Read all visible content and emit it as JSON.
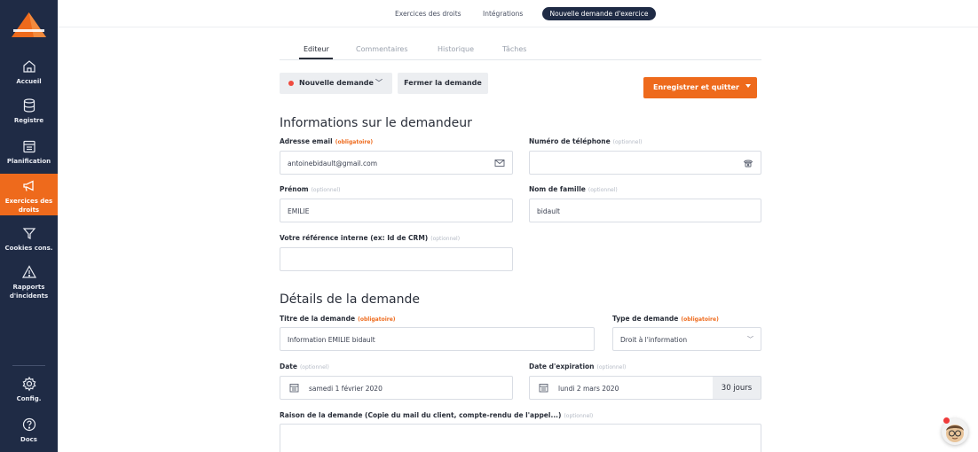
{
  "sidebar": {
    "items": [
      {
        "label": "Accueil",
        "icon": "home-icon"
      },
      {
        "label": "Registre",
        "icon": "database-icon"
      },
      {
        "label": "Planification",
        "icon": "calendar-icon"
      },
      {
        "label": "Exercices des droits",
        "icon": "megaphone-icon",
        "active": true
      },
      {
        "label": "Cookies cons.",
        "icon": "filter-icon"
      },
      {
        "label": "Rapports d'incidents",
        "icon": "warning-icon"
      }
    ],
    "bottom": [
      {
        "label": "Config.",
        "icon": "gear-icon"
      },
      {
        "label": "Docs",
        "icon": "help-icon"
      }
    ]
  },
  "topnav": {
    "links": [
      "Exercices des droits",
      "Intégrations"
    ],
    "active_pill": "Nouvelle demande d'exercice"
  },
  "tabs": [
    "Editeur",
    "Commentaires",
    "Historique",
    "Tâches"
  ],
  "toolbar": {
    "status_label": "Nouvelle demande",
    "close_label": "Fermer la demande",
    "save_label": "Enregistrer et quitter"
  },
  "requester": {
    "title": "Informations sur le demandeur",
    "email": {
      "label": "Adresse email",
      "tag": "(obligatoire)",
      "value": "antoinebidault@gmail.com"
    },
    "phone": {
      "label": "Numéro de téléphone",
      "tag": "(optionnel)",
      "value": ""
    },
    "firstname": {
      "label": "Prénom",
      "tag": "(optionnel)",
      "value": "EMILIE"
    },
    "lastname": {
      "label": "Nom de famille",
      "tag": "(optionnel)",
      "value": "bidault"
    },
    "reference": {
      "label": "Votre référence interne (ex: Id de CRM)",
      "tag": "(optionnel)",
      "value": ""
    }
  },
  "details": {
    "title": "Détails de la demande",
    "request_title": {
      "label": "Titre de la demande",
      "tag": "(obligatoire)",
      "value": "Information EMILIE bidault"
    },
    "request_type": {
      "label": "Type de demande",
      "tag": "(obligatoire)",
      "value": "Droit à l'information"
    },
    "date": {
      "label": "Date",
      "tag": "(optionnel)",
      "value": "samedi 1 février 2020"
    },
    "expiration": {
      "label": "Date d'expiration",
      "tag": "(optionnel)",
      "value": "lundi 2 mars 2020",
      "addon": "30 jours"
    },
    "reason": {
      "label": "Raison de la demande (Copie du mail du client, compte-rendu de l'appel...)",
      "tag": "(optionnel)",
      "value": ""
    }
  },
  "colors": {
    "sidebar_bg": "#1f2b45",
    "accent": "#ee6a1c",
    "status_dot": "#ef4b3f"
  }
}
